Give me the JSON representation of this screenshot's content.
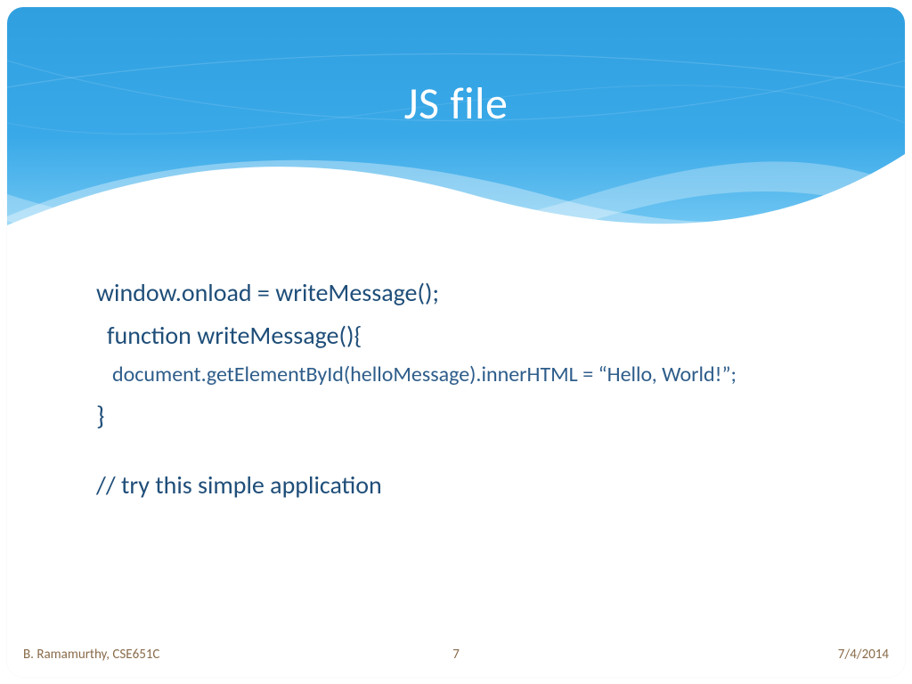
{
  "title": "JS file",
  "code": {
    "l1": "window.onload = writeMessage();",
    "l2": "function writeMessage(){",
    "l3": "document.getElementById(helloMessage).innerHTML = “Hello, World!”;",
    "l4": "}",
    "l5": "// try this simple application"
  },
  "footer": {
    "author": "B. Ramamurthy, CSE651C",
    "page": "7",
    "date": "7/4/2014"
  }
}
